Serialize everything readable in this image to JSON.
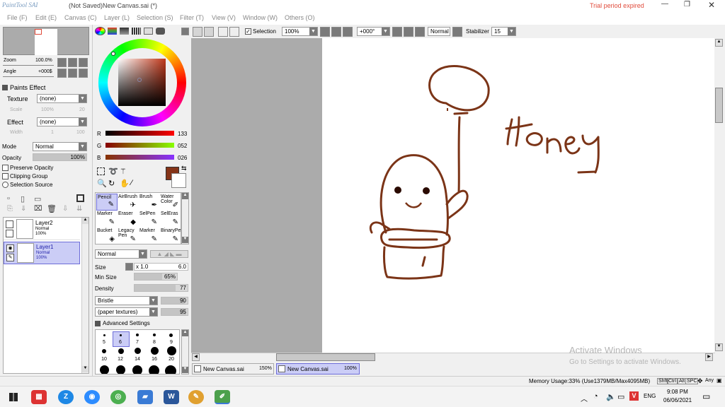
{
  "app": {
    "logo_text": "PaintTool SAI",
    "title": "(Not Saved)New Canvas.sai (*)",
    "trial": "Trial period expired"
  },
  "menu": [
    "File (F)",
    "Edit (E)",
    "Canvas (C)",
    "Layer (L)",
    "Selection (S)",
    "Filter (T)",
    "View (V)",
    "Window (W)",
    "Others (O)"
  ],
  "navigator": {
    "zoom_label": "Zoom",
    "zoom_value": "100.0%",
    "angle_label": "Angle",
    "angle_value": "+000$"
  },
  "paints_effect": {
    "header": "Paints Effect",
    "texture_label": "Texture",
    "texture_value": "(none)",
    "scale_label": "Scale",
    "scale_value": "100%",
    "scale_num": "20",
    "effect_label": "Effect",
    "effect_value": "(none)",
    "width_label": "Width",
    "width_value": "1",
    "width_num": "100"
  },
  "layer_props": {
    "mode_label": "Mode",
    "mode_value": "Normal",
    "opacity_label": "Opacity",
    "opacity_value": "100%",
    "preserve": "Preserve Opacity",
    "clipping": "Clipping Group",
    "selsource": "Selection Source"
  },
  "layers": [
    {
      "name": "Layer2",
      "mode": "Normal",
      "opacity": "100%"
    },
    {
      "name": "Layer1",
      "mode": "Normal",
      "opacity": "100%"
    }
  ],
  "color": {
    "r_label": "R",
    "r_value": "133",
    "g_label": "G",
    "g_value": "052",
    "b_label": "B",
    "b_value": "026",
    "current": "#853418"
  },
  "tools": [
    {
      "name": "Pencil",
      "icon": "pencil-icon",
      "glyph": "✎"
    },
    {
      "name": "AirBrush",
      "icon": "airbrush-icon",
      "glyph": "✈"
    },
    {
      "name": "Brush",
      "icon": "brush-icon",
      "glyph": "✒"
    },
    {
      "name": "Water Color",
      "icon": "watercolor-icon",
      "glyph": "✐"
    },
    {
      "name": "Marker",
      "icon": "marker-icon",
      "glyph": "✎"
    },
    {
      "name": "Eraser",
      "icon": "eraser-icon",
      "glyph": "◆"
    },
    {
      "name": "SelPen",
      "icon": "selpen-icon",
      "glyph": "✎"
    },
    {
      "name": "SelEras",
      "icon": "seleras-icon",
      "glyph": "✎"
    },
    {
      "name": "Bucket",
      "icon": "bucket-icon",
      "glyph": "◈"
    },
    {
      "name": "Legacy Pen",
      "icon": "legacypen-icon",
      "glyph": "✎"
    },
    {
      "name": "Marker",
      "icon": "marker-icon",
      "glyph": "✎"
    },
    {
      "name": "BinaryPe",
      "icon": "binarypen-icon",
      "glyph": "✎"
    }
  ],
  "brush": {
    "blend_value": "Normal",
    "size_label": "Size",
    "size_mult": "x 1.0",
    "size_value": "6.0",
    "minsize_label": "Min Size",
    "minsize_value": "65%",
    "minsize_fraction": 0.65,
    "density_label": "Density",
    "density_value": "77",
    "density_fraction": 0.77,
    "shape_value": "Bristle",
    "shape_num": "90",
    "texture_value": "(paper textures)",
    "texture_num": "95",
    "advanced": "Advanced Settings",
    "sizes": [
      "5",
      "6",
      "7",
      "8",
      "9",
      "10",
      "12",
      "14",
      "16",
      "20"
    ]
  },
  "toolbar": {
    "selection_label": "Selection",
    "zoom": "100%",
    "angle": "+000°",
    "blend": "Normal",
    "stabilizer_label": "Stabilizer",
    "stabilizer_value": "15"
  },
  "canvas": {
    "drawing_text": "Honey"
  },
  "doc_tabs": [
    {
      "name": "New Canvas.sai",
      "zoom": "150%"
    },
    {
      "name": "New Canvas.sai",
      "zoom": "100%"
    }
  ],
  "status": {
    "memory": "Memory Usage:33% (Use1379MB/Max4095MB)",
    "keys": [
      "Shft",
      "Ctrl",
      "Alt",
      "SPC"
    ],
    "any": "Any"
  },
  "watermark": {
    "title": "Activate Windows",
    "sub": "Go to Settings to activate Windows."
  },
  "taskbar": {
    "time": "9:08 PM",
    "date": "06/06/2021",
    "lang": "ENG"
  }
}
